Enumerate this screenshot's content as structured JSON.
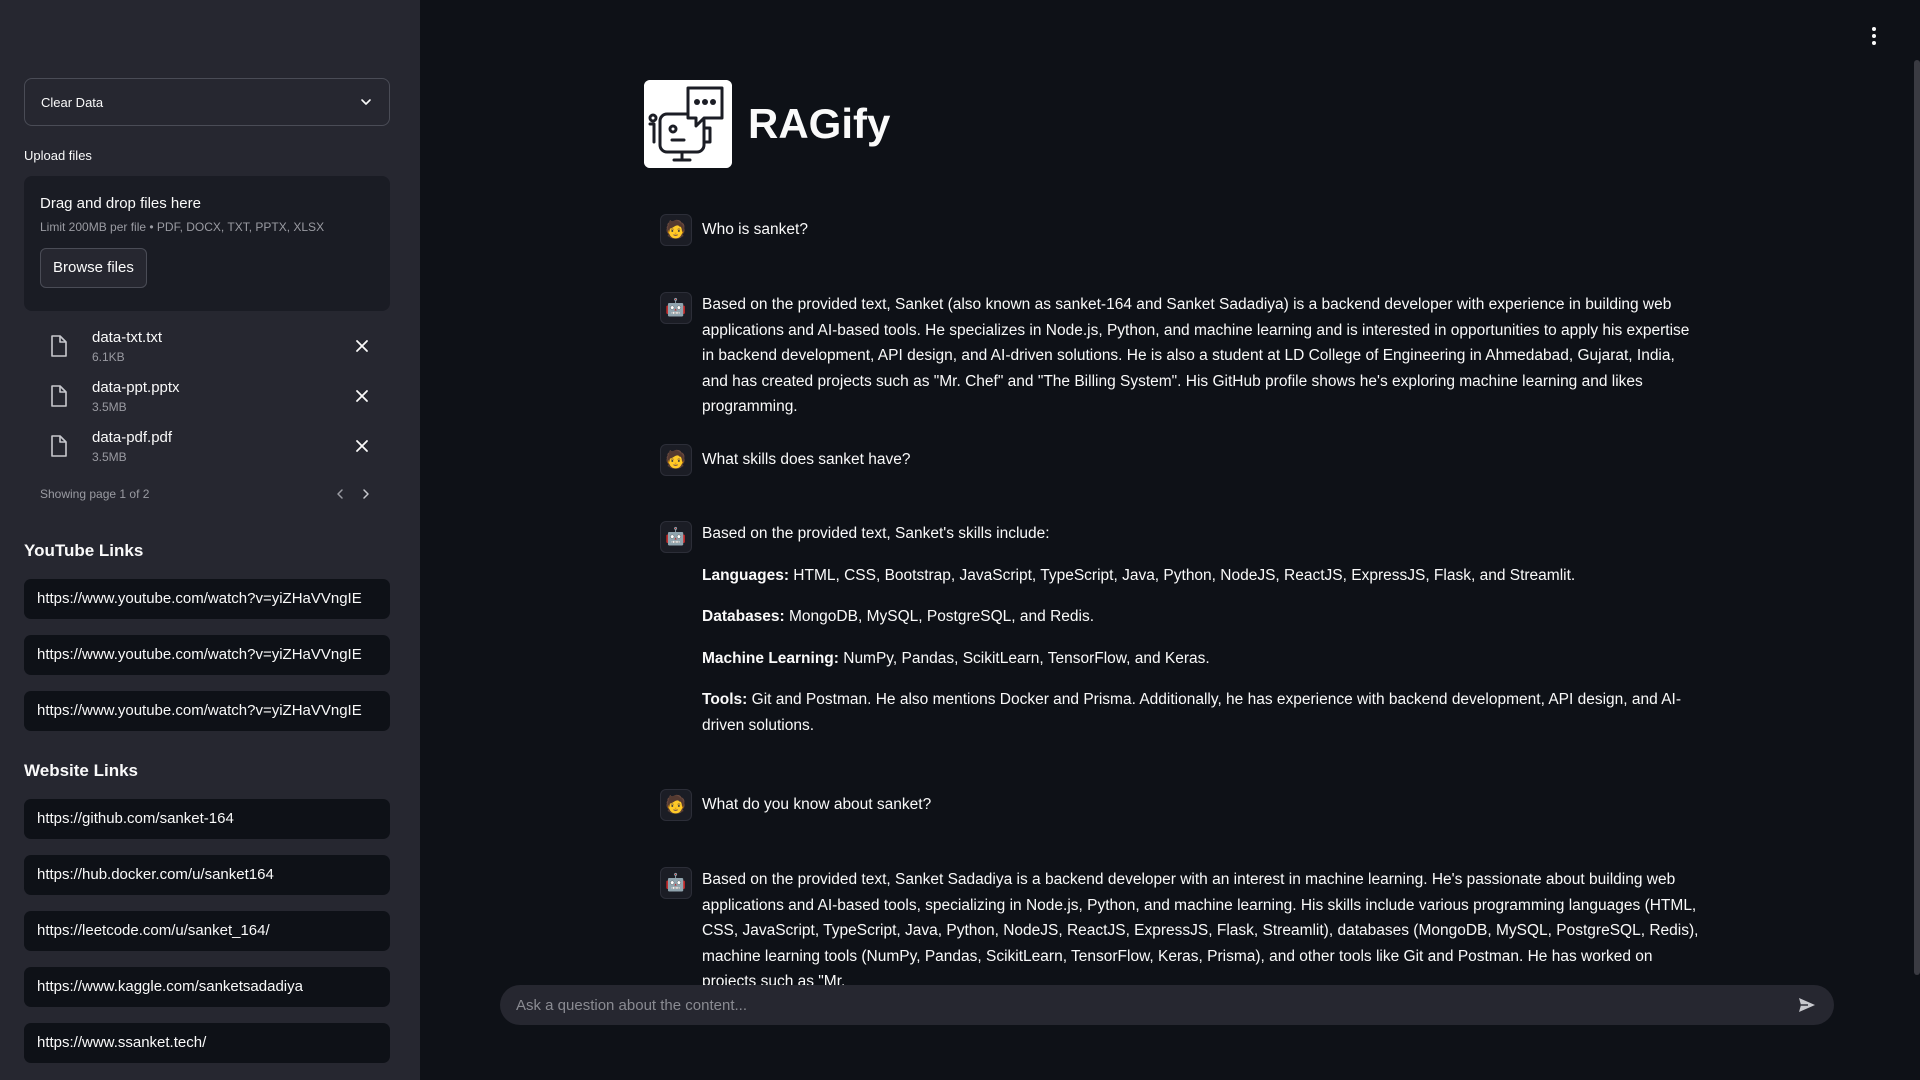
{
  "sidebar": {
    "select_value": "Clear Data",
    "upload_label": "Upload files",
    "dropzone": {
      "title": "Drag and drop files here",
      "limit": "Limit 200MB per file • PDF, DOCX, TXT, PPTX, XLSX",
      "browse_label": "Browse files"
    },
    "files": [
      {
        "name": "data-txt.txt",
        "size": "6.1KB"
      },
      {
        "name": "data-ppt.pptx",
        "size": "3.5MB"
      },
      {
        "name": "data-pdf.pdf",
        "size": "3.5MB"
      }
    ],
    "pager_text": "Showing page 1 of 2",
    "youtube_title": "YouTube Links",
    "youtube_links": [
      "https://www.youtube.com/watch?v=yiZHaVVngIE",
      "https://www.youtube.com/watch?v=yiZHaVVngIE",
      "https://www.youtube.com/watch?v=yiZHaVVngIE"
    ],
    "website_title": "Website Links",
    "website_links": [
      "https://github.com/sanket-164",
      "https://hub.docker.com/u/sanket164",
      "https://leetcode.com/u/sanket_164/",
      "https://www.kaggle.com/sanketsadadiya",
      "https://www.ssanket.tech/"
    ]
  },
  "main": {
    "title": "RAGify",
    "messages": [
      {
        "role": "user",
        "avatar": "🧑",
        "text": "Who is sanket?"
      },
      {
        "role": "assistant",
        "avatar": "🤖",
        "text": "Based on the provided text, Sanket (also known as sanket-164 and Sanket Sadadiya) is a backend developer with experience in building web applications and AI-based tools. He specializes in Node.js, Python, and machine learning and is interested in opportunities to apply his expertise in backend development, API design, and AI-driven solutions. He is also a student at LD College of Engineering in Ahmedabad, Gujarat, India, and has created projects such as \"Mr. Chef\" and \"The Billing System\". His GitHub profile shows he's exploring machine learning and likes programming."
      },
      {
        "role": "user",
        "avatar": "🧑",
        "text": "What skills does sanket have?"
      },
      {
        "role": "assistant",
        "avatar": "🤖",
        "intro": "Based on the provided text, Sanket's skills include:",
        "items": [
          {
            "label": "Languages:",
            "text": " HTML, CSS, Bootstrap, JavaScript, TypeScript, Java, Python, NodeJS, ReactJS, ExpressJS, Flask, and Streamlit."
          },
          {
            "label": "Databases:",
            "text": " MongoDB, MySQL, PostgreSQL, and Redis."
          },
          {
            "label": "Machine Learning:",
            "text": " NumPy, Pandas, ScikitLearn, TensorFlow, and Keras."
          },
          {
            "label": "Tools:",
            "text": " Git and Postman. He also mentions Docker and Prisma. Additionally, he has experience with backend development, API design, and AI-driven solutions."
          }
        ]
      },
      {
        "role": "user",
        "avatar": "🧑",
        "text": "What do you know about sanket?"
      },
      {
        "role": "assistant",
        "avatar": "🤖",
        "text": "Based on the provided text, Sanket Sadadiya is a backend developer with an interest in machine learning. He's passionate about building web applications and AI-based tools, specializing in Node.js, Python, and machine learning. His skills include various programming languages (HTML, CSS, JavaScript, TypeScript, Java, Python, NodeJS, ReactJS, ExpressJS, Flask, Streamlit), databases (MongoDB, MySQL, PostgreSQL, Redis), machine learning tools (NumPy, Pandas, ScikitLearn, TensorFlow, Keras, Prisma), and other tools like Git and Postman. He has worked on projects such as \"Mr."
      }
    ],
    "chat_placeholder": "Ask a question about the content..."
  }
}
